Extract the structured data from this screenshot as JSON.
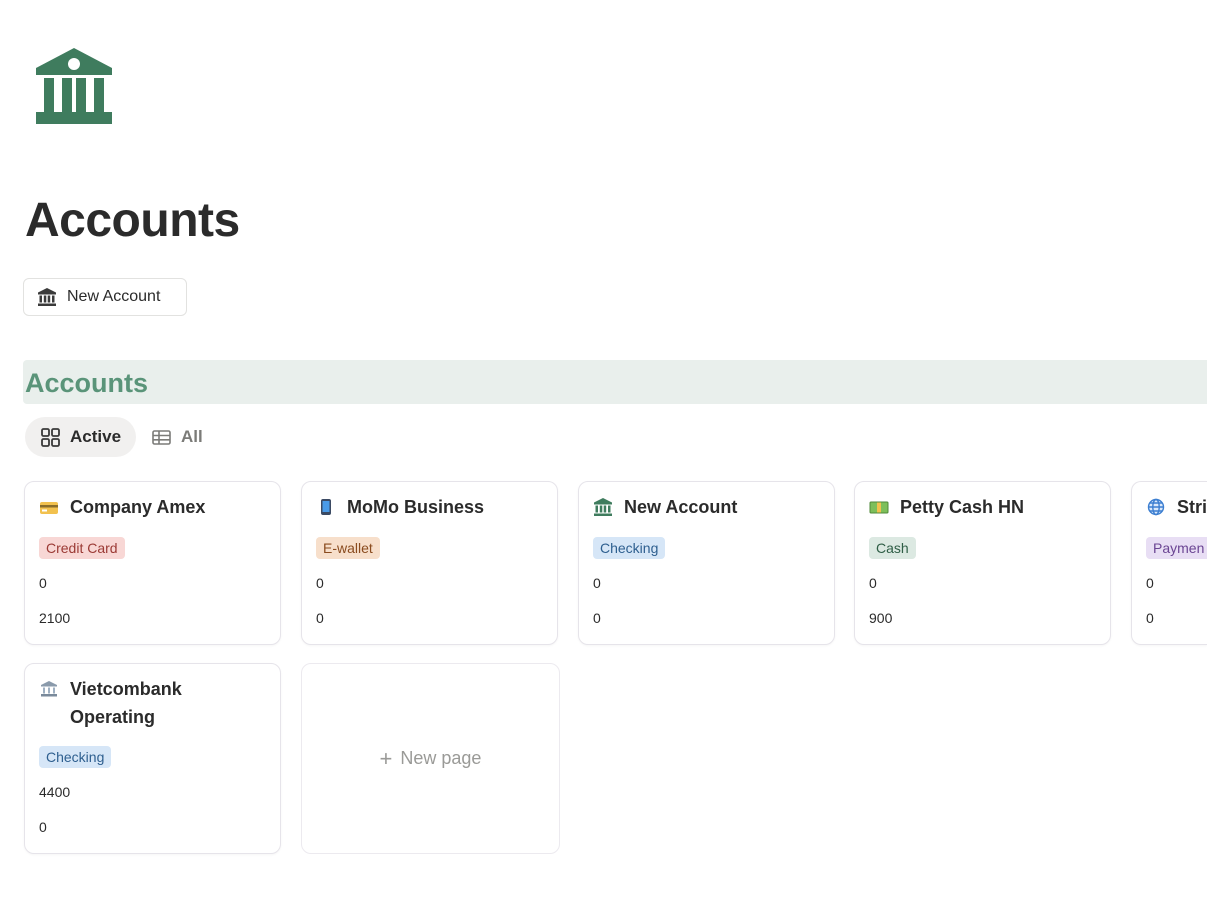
{
  "page": {
    "title": "Accounts",
    "icon": "bank-icon",
    "accent_color": "#3f7c5e"
  },
  "actions": {
    "new_account_label": "New Account"
  },
  "database": {
    "title": "Accounts",
    "views": [
      {
        "label": "Active",
        "icon": "gallery-icon",
        "selected": true
      },
      {
        "label": "All",
        "icon": "table-icon",
        "selected": false
      }
    ],
    "cards": [
      {
        "title": "Company Amex",
        "icon": "credit-card-icon",
        "type": "Credit Card",
        "type_color": "#f8d7d5",
        "type_text_color": "#9b3a35",
        "value1": "0",
        "value2": "2100"
      },
      {
        "title": "MoMo Business",
        "icon": "mobile-phone-icon",
        "type": "E-wallet",
        "type_color": "#f7dfcb",
        "type_text_color": "#8a4b1e",
        "value1": "0",
        "value2": "0"
      },
      {
        "title": "New Account",
        "icon": "bank-icon",
        "type": "Checking",
        "type_color": "#d6e6f7",
        "type_text_color": "#2e5f8f",
        "value1": "0",
        "value2": "0"
      },
      {
        "title": "Petty Cash HN",
        "icon": "money-icon",
        "type": "Cash",
        "type_color": "#dce9e2",
        "type_text_color": "#2f5e46",
        "value1": "0",
        "value2": "900"
      },
      {
        "title": "Stri",
        "icon": "globe-icon",
        "type": "Paymen",
        "type_color": "#e8def4",
        "type_text_color": "#6b4593",
        "value1": "0",
        "value2": "0"
      },
      {
        "title_line1": "Vietcombank",
        "title_line2": "Operating",
        "icon": "classical-building-icon",
        "type": "Checking",
        "type_color": "#d6e6f7",
        "type_text_color": "#2e5f8f",
        "value1": "4400",
        "value2": "0"
      }
    ],
    "new_page_label": "New page"
  }
}
